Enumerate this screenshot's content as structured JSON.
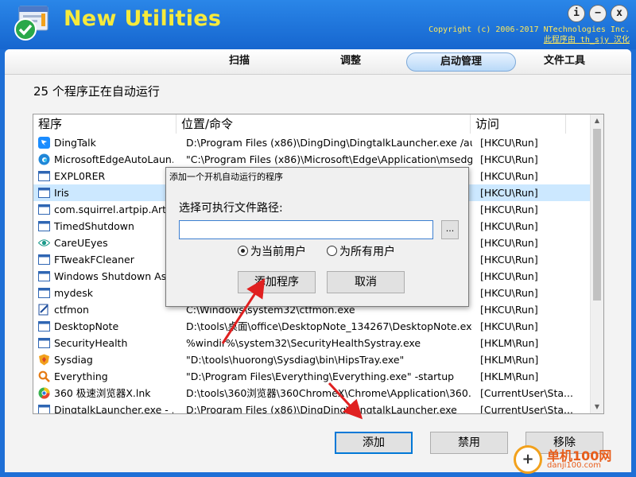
{
  "app": {
    "title": "New Utilities",
    "copyright_line1": "Copyright (c) 2006-2017 NTechnologies Inc.",
    "copyright_line2": "此程序由 th_sjy 汉化",
    "window_buttons": {
      "info": "i",
      "minimize": "−",
      "close": "x"
    },
    "colors": {
      "header": "#1e6fd6",
      "title": "#f6ea3c",
      "selection": "#cce8ff",
      "arrow": "#e02020"
    }
  },
  "tabs": [
    {
      "label": "扫描",
      "active": false
    },
    {
      "label": "调整",
      "active": false
    },
    {
      "label": "启动管理",
      "active": true
    },
    {
      "label": "文件工具",
      "active": false
    }
  ],
  "status_text": "25 个程序正在自动运行",
  "table": {
    "columns": [
      "程序",
      "位置/命令",
      "访问"
    ],
    "rows": [
      {
        "name": "DingTalk",
        "command": "D:\\Program Files (x86)\\DingDing\\DingtalkLauncher.exe /aut...",
        "access": "[HKCU\\Run]",
        "icon": "dingtalk-icon"
      },
      {
        "name": "MicrosoftEdgeAutoLaun...",
        "command": "\"C:\\Program Files (x86)\\Microsoft\\Edge\\Application\\msedg...",
        "access": "[HKCU\\Run]",
        "icon": "edge-icon"
      },
      {
        "name": "EXPL0RER",
        "command": "",
        "access": "[HKCU\\Run]",
        "icon": "window-icon"
      },
      {
        "name": "Iris",
        "command": "",
        "access": "[HKCU\\Run]",
        "icon": "window-icon"
      },
      {
        "name": "com.squirrel.artpip.Artpip",
        "command": "",
        "access": "[HKCU\\Run]",
        "icon": "window-icon"
      },
      {
        "name": "TimedShutdown",
        "command": "",
        "access": "[HKCU\\Run]",
        "icon": "window-icon"
      },
      {
        "name": "CareUEyes",
        "command": "",
        "access": "[HKCU\\Run]",
        "icon": "eye-icon"
      },
      {
        "name": "FTweakFCleaner",
        "command": "",
        "access": "[HKCU\\Run]",
        "icon": "window-icon"
      },
      {
        "name": "Windows Shutdown Assi...",
        "command": "",
        "access": "[HKCU\\Run]",
        "icon": "window-icon"
      },
      {
        "name": "mydesk",
        "command": "",
        "access": "[HKCU\\Run]",
        "icon": "window-icon"
      },
      {
        "name": "ctfmon",
        "command": "C:\\Windows\\system32\\ctfmon.exe",
        "access": "[HKCU\\Run]",
        "icon": "ctfmon-icon"
      },
      {
        "name": "DesktopNote",
        "command": "D:\\tools\\桌面\\office\\DesktopNote_134267\\DesktopNote.exe",
        "access": "[HKCU\\Run]",
        "icon": "window-icon"
      },
      {
        "name": "SecurityHealth",
        "command": "%windir%\\system32\\SecurityHealthSystray.exe",
        "access": "[HKLM\\Run]",
        "icon": "window-icon"
      },
      {
        "name": "Sysdiag",
        "command": "\"D:\\tools\\huorong\\Sysdiag\\bin\\HipsTray.exe\"",
        "access": "[HKLM\\Run]",
        "icon": "shield-icon"
      },
      {
        "name": "Everything",
        "command": "\"D:\\Program Files\\Everything\\Everything.exe\" -startup",
        "access": "[HKLM\\Run]",
        "icon": "magnifier-icon"
      },
      {
        "name": "360 极速浏览器X.lnk",
        "command": "D:\\tools\\360浏览器\\360ChromeX\\Chrome\\Application\\360...",
        "access": "[CurrentUser\\Sta...",
        "icon": "browser-360-icon"
      },
      {
        "name": "DingtalkLauncher.exe - ...",
        "command": "D:\\Program Files (x86)\\DingDing\\DingtalkLauncher.exe",
        "access": "[CurrentUser\\Sta...",
        "icon": "window-icon"
      }
    ]
  },
  "buttons": {
    "add": "添加",
    "disable": "禁用",
    "remove": "移除"
  },
  "dialog": {
    "title": "添加一个开机自动运行的程序",
    "label": "选择可执行文件路径:",
    "path_value": "",
    "browse": "...",
    "radio_current": "为当前用户",
    "radio_all": "为所有用户",
    "selected_option": "current",
    "add_button": "添加程序",
    "cancel_button": "取消"
  },
  "watermark": {
    "site": "单机100网",
    "url": "danji100.com"
  }
}
